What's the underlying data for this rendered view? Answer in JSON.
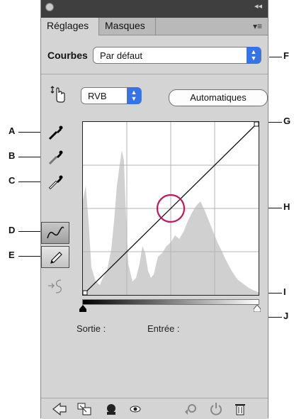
{
  "tabs": [
    {
      "label": "Réglages",
      "active": true
    },
    {
      "label": "Masques",
      "active": false
    }
  ],
  "header": {
    "title": "Courbes",
    "preset_value": "Par défaut"
  },
  "controls": {
    "channel_value": "RVB",
    "auto_label": "Automatiques"
  },
  "graph": {
    "input_label": "Entrée :",
    "output_label": "Sortie :"
  },
  "callouts": [
    "A",
    "B",
    "C",
    "D",
    "E",
    "F",
    "G",
    "H",
    "I",
    "J"
  ],
  "colors": {
    "panel_bg": "#d4d4d4",
    "accent": "#3473e8",
    "highlight_circle": "#c2185b",
    "histogram": "#d0d0d0"
  }
}
